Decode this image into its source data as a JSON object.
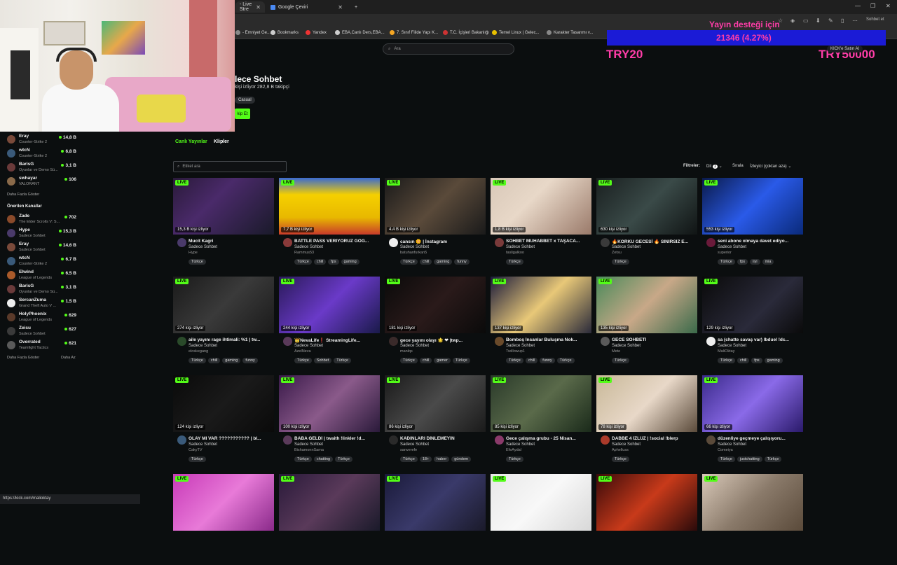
{
  "browser": {
    "tabs": [
      {
        "label": "- Live Stre",
        "active": true
      },
      {
        "label": "Google Çeviri",
        "active": false
      }
    ],
    "new_tab": "+",
    "window_controls": [
      "—",
      "❐",
      "✕"
    ],
    "bookmarks": [
      {
        "label": "- Emniyet Ge...",
        "color": "#888"
      },
      {
        "label": "Bookmarks",
        "color": "#ccc"
      },
      {
        "label": "Yandex",
        "color": "#e33"
      },
      {
        "label": "EBA,Canlı Ders,EBA...",
        "color": "#ccc"
      },
      {
        "label": "7. Sınıf Fiilde Yapı K...",
        "color": "#f5a623"
      },
      {
        "label": "T.C. İçişleri Bakanlığı",
        "color": "#c33"
      },
      {
        "label": "Temel Linux | Gelec...",
        "color": "#e8c000"
      },
      {
        "label": "Karakter Tasarımı v...",
        "color": "#888"
      }
    ],
    "toolbar_right_label": "Sohbet et"
  },
  "overlay": {
    "title": "Yayın desteği için",
    "progress_text": "21346 (4.27%)",
    "progress_percent": 4.27,
    "promo_left": "TRY20",
    "promo_right": "TRY50000",
    "kick_badge": "KICK'e Satın Al",
    "bar_color": "#1b1bd6",
    "text_color": "#ff3da8"
  },
  "site": {
    "search_placeholder": "Ara",
    "category_title": "lece Sohbet",
    "category_stats": "kişi izliyor  282,8 B takipçi",
    "category_tag": "Casual",
    "follow_label": "kip Et",
    "accent": "#53fc18"
  },
  "sidebar": {
    "followed": [
      {
        "name": "Eray",
        "game": "Counter-Strike 2",
        "count": "14,8 B",
        "color": "#7a4a3a"
      },
      {
        "name": "wtcN",
        "game": "Counter-Strike 2",
        "count": "6,8 B",
        "color": "#3a5a7a"
      },
      {
        "name": "BarisG",
        "game": "Oyunlar ve Demo Sü...",
        "count": "3,1 B",
        "color": "#6a3a3a"
      },
      {
        "name": "swhayar",
        "game": "VALORANT",
        "count": "106",
        "color": "#8a6a4a"
      }
    ],
    "more_label": "Daha Fazla Göster",
    "recommended_heading": "Önerilen Kanallar",
    "recommended": [
      {
        "name": "Zade",
        "game": "The Elder Scrolls V: S...",
        "count": "702",
        "color": "#8a4a2a"
      },
      {
        "name": "Hype",
        "game": "Sadece Sohbet",
        "count": "15,3 B",
        "color": "#4a3a6a"
      },
      {
        "name": "Eray",
        "game": "Sadece Sohbet",
        "count": "14,6 B",
        "color": "#7a4a3a"
      },
      {
        "name": "wtcN",
        "game": "Counter-Strike 2",
        "count": "6,7 B",
        "color": "#3a5a7a"
      },
      {
        "name": "Elwind",
        "game": "League of Legends",
        "count": "6,5 B",
        "color": "#aa5a2a"
      },
      {
        "name": "BarisG",
        "game": "Oyunlar ve Demo Sü...",
        "count": "3,1 B",
        "color": "#6a3a3a"
      },
      {
        "name": "SercanZuma",
        "game": "Grand Theft Auto V ...",
        "count": "1,5 B",
        "color": "#eeeeee"
      },
      {
        "name": "HolyPhoenix",
        "game": "League of Legends",
        "count": "629",
        "color": "#5a3a2a"
      },
      {
        "name": "Zeisu",
        "game": "Sadece Sohbet",
        "count": "627",
        "color": "#3a3a3a"
      },
      {
        "name": "Overrated",
        "game": "Teamfight Tactics",
        "count": "621",
        "color": "#5a5a5a"
      }
    ],
    "more_label_2": "Daha Fazla Göster",
    "less_label": "Daha Az"
  },
  "content": {
    "tabs": [
      {
        "label": "Canlı Yayınlar",
        "active": true
      },
      {
        "label": "Klipler",
        "active": false
      }
    ],
    "tag_search_placeholder": "Etiket ara",
    "filter_label": "Filtreler:",
    "filter_lang": "Dil",
    "filter_lang_count": "1",
    "sort_label": "Sırala",
    "sort_value": "İzleyici (çoktan aza)",
    "live_label": "LIVE",
    "cards": [
      {
        "title": "Mucit Kagri",
        "category": "Sadece Sohbet",
        "user": "Hype",
        "viewers": "15,3 B kişi izliyor",
        "tags": [
          "Türkçe"
        ],
        "bg": "linear-gradient(135deg,#2a1a3a,#4a2a6a 40%,#1a1a2a)",
        "av": "#4a3a6a"
      },
      {
        "title": "BATTLE PASS VERİYORUZ GOG...",
        "category": "Sadece Sohbet",
        "user": "Rammus53",
        "viewers": "7,7 B kişi izliyor",
        "tags": [
          "Türkçe",
          "chill",
          "fps",
          "gaming"
        ],
        "bg": "linear-gradient(180deg,#3a6ad0,#f5d000 30%,#e8b800 70%,#c83a2a)",
        "av": "#8a3a3a"
      },
      {
        "title": "cansın 🌼 | İnstagram",
        "category": "Sadece Sohbet",
        "user": "batuhanfurkan5",
        "viewers": "4,4 B kişi izliyor",
        "tags": [
          "Türkçe",
          "chill",
          "gaming",
          "funny"
        ],
        "bg": "linear-gradient(135deg,#1a1a1a,#5a4a3a 50%,#1a1a1a)",
        "av": "#eeeeee"
      },
      {
        "title": "SOHBET MUHABBET x TAŞACA...",
        "category": "Sadece Sohbet",
        "user": "tasligalkoo",
        "viewers": "1,8 B kişi izliyor",
        "tags": [
          "Türkçe"
        ],
        "bg": "linear-gradient(135deg,#d8c8b8,#e8d8c8 40%,#9a7a6a)",
        "av": "#7a3a3a"
      },
      {
        "title": "🔥KORKU GECESİ 🔥 SINIRSIZ E...",
        "category": "Sadece Sohbet",
        "user": "Zetsu",
        "viewers": "630 kişi izliyor",
        "tags": [
          "Türkçe"
        ],
        "bg": "linear-gradient(135deg,#1a2020,#3a4a48 50%,#101414)",
        "av": "#3a3a3a"
      },
      {
        "title": "seni abone olmaya davet ediyo...",
        "category": "Sadece Sohbet",
        "user": "superior",
        "viewers": "553 kişi izliyor",
        "tags": [
          "Türkçe",
          "fps",
          "iiyi",
          "mia"
        ],
        "bg": "linear-gradient(135deg,#0a1a4a,#2a5ae8 50%,#0a2a7a)",
        "av": "#6a1a3a"
      },
      {
        "title": "aile yayını rage ihtimali: %1 | tw...",
        "category": "Sadece Sohbet",
        "user": "eloskegang",
        "viewers": "274 kişi izliyor",
        "tags": [
          "Türkçe",
          "chill",
          "gaming",
          "funny"
        ],
        "bg": "linear-gradient(135deg,#1a1a1a,#3a3a3a 50%,#1a1a1a)",
        "av": "#2a4a2a"
      },
      {
        "title": "👑NevaLife❗ StreamingLife...",
        "category": "Sadece Sohbet",
        "user": "AzelNeva",
        "viewers": "244 kişi izliyor",
        "tags": [
          "Türkçe",
          "Sohbet",
          "Türkçe"
        ],
        "bg": "linear-gradient(135deg,#2a1a5a,#6a3ac8 50%,#1a1a4a)",
        "av": "#5a3a5a"
      },
      {
        "title": "gece yayını olayı 🌟 ❤ |twp...",
        "category": "Sadece Sohbet",
        "user": "manlqs",
        "viewers": "181 kişi izliyor",
        "tags": [
          "Türkçe",
          "chill",
          "gamer",
          "Türkçe"
        ],
        "bg": "linear-gradient(135deg,#0a0a0a,#2a1a1a 50%,#0a0a0a)",
        "av": "#3a2a2a"
      },
      {
        "title": "Bomboş İnsanlar Buluşma Nok...",
        "category": "Sadece Sohbet",
        "user": "Twillowup1",
        "viewers": "137 kişi izliyor",
        "tags": [
          "Türkçe",
          "chill",
          "funny",
          "Türkçe"
        ],
        "bg": "linear-gradient(135deg,#1a1a3a,#e8c878 50%,#2a2a3a)",
        "av": "#6a4a2a"
      },
      {
        "title": "GECE SOHBETİ",
        "category": "Sadece Sohbet",
        "user": "Mete",
        "viewers": "135 kişi izliyor",
        "tags": [
          "Türkçe"
        ],
        "bg": "linear-gradient(135deg,#4a8a5a,#c8a888 50%,#3a6a4a)",
        "av": "#5a5a5a"
      },
      {
        "title": "sa (chatte savaş var) Ibduel !dc...",
        "category": "Sadece Sohbet",
        "user": "MaliOktay",
        "viewers": "129 kişi izliyor",
        "tags": [
          "Türkçe",
          "chill",
          "fps",
          "gaming"
        ],
        "bg": "linear-gradient(135deg,#0a0a0a,#2a2a3a 60%,#0a0a0a)",
        "av": "#eeeeee"
      },
      {
        "title": "OLAY MI VAR ??????????? | bl...",
        "category": "Sadece Sohbet",
        "user": "CakyTV",
        "viewers": "124 kişi izliyor",
        "tags": [
          "Türkçe"
        ],
        "bg": "linear-gradient(135deg,#0a0a0a,#1a1a1a 50%,#0a0a0a)",
        "av": "#3a5a7a"
      },
      {
        "title": "BABA GELDİ | twaith !linkler !d...",
        "category": "Sadece Sohbet",
        "user": "BishamonnSama",
        "viewers": "100 kişi izliyor",
        "tags": [
          "Türkçe",
          "chatting",
          "Türkçe"
        ],
        "bg": "linear-gradient(135deg,#3a1a4a,#8a5a8a 50%,#2a1a3a)",
        "av": "#5a3a5a"
      },
      {
        "title": "KADINLARI DİNLEMEYİN",
        "category": "Sadece Sohbet",
        "user": "sanverefe",
        "viewers": "86 kişi izliyor",
        "tags": [
          "Türkçe",
          "18+",
          "haber",
          "gündem"
        ],
        "bg": "linear-gradient(135deg,#1a1a1a,#4a4a4a 50%,#1a1a1a)",
        "av": "#2a2a2a"
      },
      {
        "title": "Gece çalışma grubu - 25 Nisan...",
        "category": "Sadece Sohbet",
        "user": "EfeAydal",
        "viewers": "85 kişi izliyor",
        "tags": [
          "Türkçe"
        ],
        "bg": "linear-gradient(135deg,#2a3a2a,#5a6a4a 50%,#1a2a1a)",
        "av": "#8a3a6a"
      },
      {
        "title": "DABBE 4 İZLÜZ | !social !blerp",
        "category": "Sadece Sohbet",
        "user": "Aphelluss",
        "viewers": "78 kişi izliyor",
        "tags": [
          "Türkçe"
        ],
        "bg": "linear-gradient(135deg,#c8b898,#e8d8c8 50%,#5a4a3a)",
        "av": "#aa3a2a"
      },
      {
        "title": "düzenliye geçmeye çalışıyoru...",
        "category": "Sadece Sohbet",
        "user": "Comeiya",
        "viewers": "66 kişi izliyor",
        "tags": [
          "Türkçe",
          "justchatting",
          "Türkçe"
        ],
        "bg": "linear-gradient(135deg,#3a2a8a,#8a6ae8 50%,#2a1a6a)",
        "av": "#5a4a3a"
      },
      {
        "title": "",
        "category": "",
        "user": "",
        "viewers": "",
        "tags": [],
        "bg": "linear-gradient(135deg,#c83ab8,#e87ad8 50%,#8a2a8a)",
        "av": "#000000"
      },
      {
        "title": "",
        "category": "",
        "user": "",
        "viewers": "",
        "tags": [],
        "bg": "linear-gradient(135deg,#2a1a3a,#5a3a5a 50%,#1a1a2a)",
        "av": "#000000"
      },
      {
        "title": "",
        "category": "",
        "user": "",
        "viewers": "",
        "tags": [],
        "bg": "linear-gradient(135deg,#1a1a3a,#3a3a6a 50%,#1a1a2a)",
        "av": "#000000"
      },
      {
        "title": "",
        "category": "",
        "user": "",
        "viewers": "",
        "tags": [],
        "bg": "linear-gradient(135deg,#e8e8e8,#f8f8f8 50%,#d8d8d8)",
        "av": "#000000"
      },
      {
        "title": "",
        "category": "",
        "user": "",
        "viewers": "",
        "tags": [],
        "bg": "linear-gradient(135deg,#3a0a0a,#c83a1a 50%,#2a0a0a)",
        "av": "#000000"
      },
      {
        "title": "",
        "category": "",
        "user": "",
        "viewers": "",
        "tags": [],
        "bg": "linear-gradient(135deg,#d8c8b8,#8a7a6a 50%,#5a4a3a)",
        "av": "#000000"
      }
    ]
  },
  "statusbar": {
    "url": "https://kick.com/malioktay"
  }
}
